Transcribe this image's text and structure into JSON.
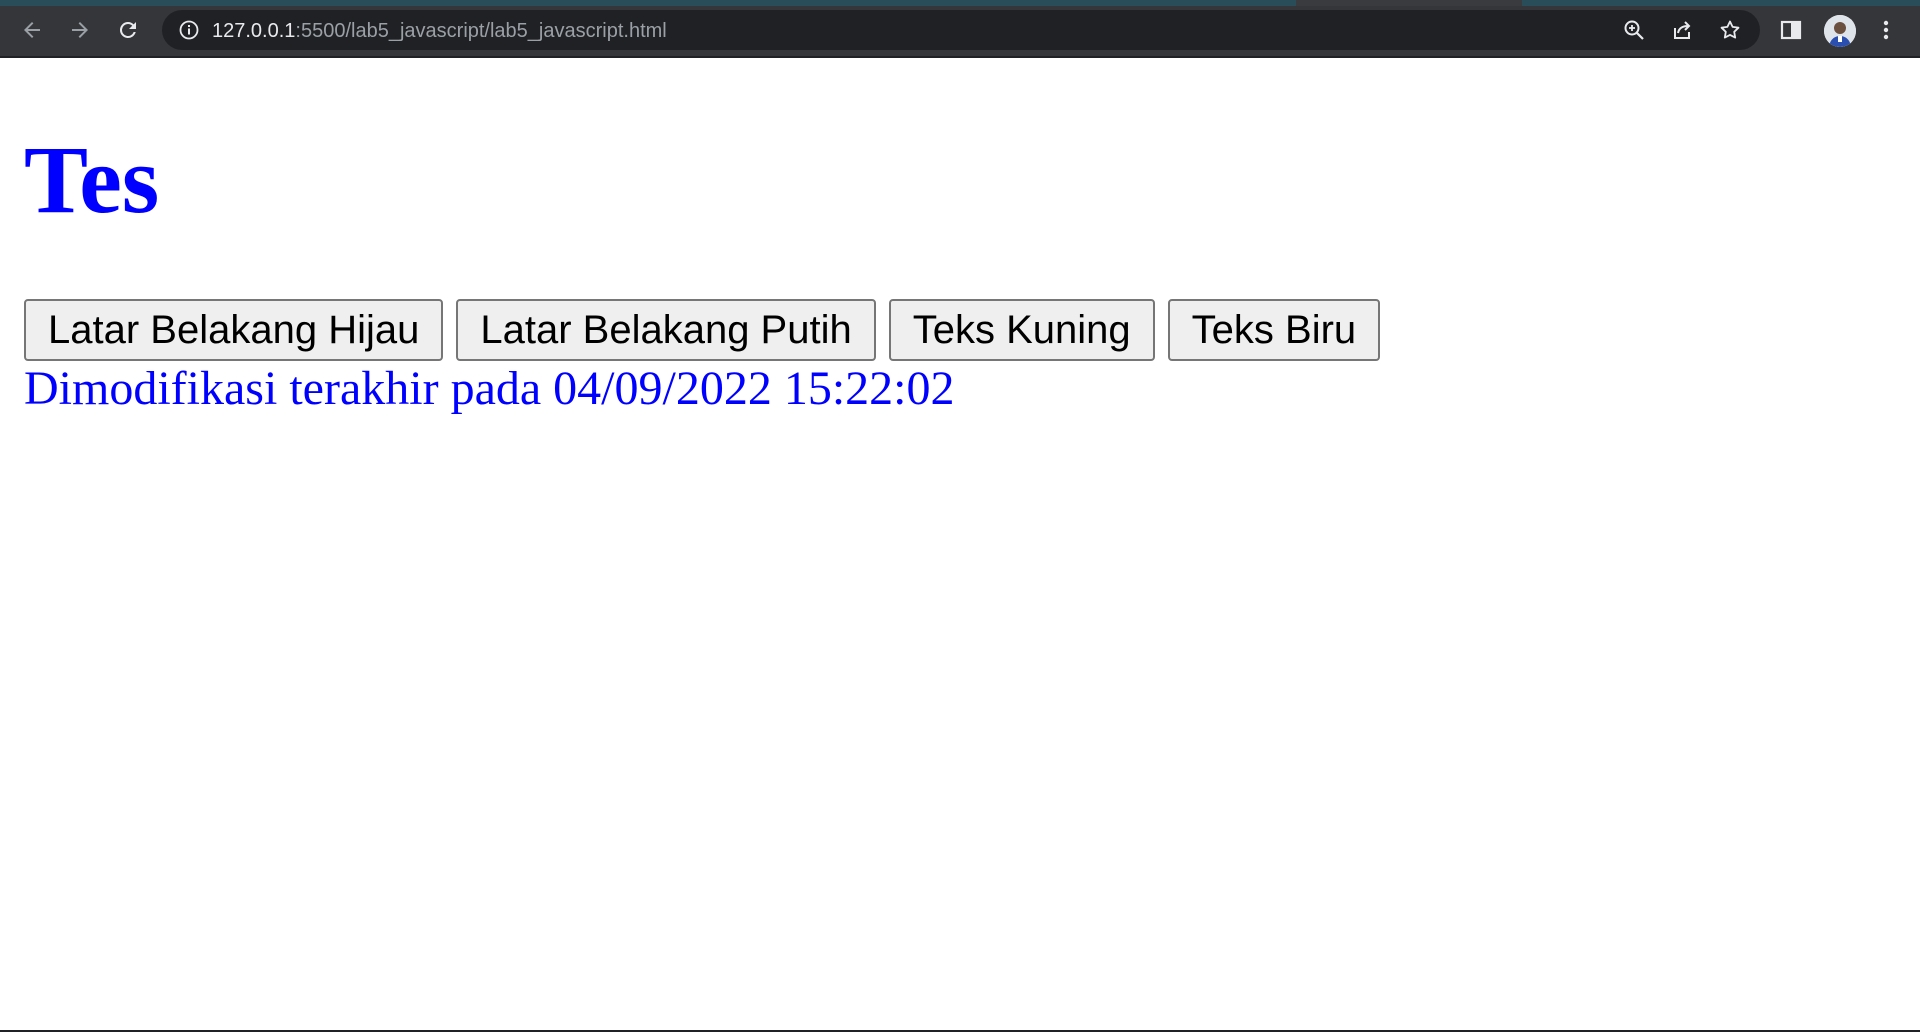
{
  "browser": {
    "url_host": "127.0.0.1",
    "url_rest": ":5500/lab5_javascript/lab5_javascript.html",
    "icons": {
      "back": "back-arrow-icon",
      "forward": "forward-arrow-icon",
      "reload": "reload-icon",
      "site_info": "info-icon",
      "zoom": "zoom-icon",
      "share": "share-icon",
      "bookmark": "star-icon",
      "side_panel": "side-panel-icon",
      "profile": "avatar",
      "menu": "kebab-menu-icon"
    }
  },
  "page": {
    "heading": "Tes",
    "buttons": [
      {
        "label": "Latar Belakang Hijau"
      },
      {
        "label": "Latar Belakang Putih"
      },
      {
        "label": "Teks Kuning"
      },
      {
        "label": "Teks Biru"
      }
    ],
    "modified_text": "Dimodifikasi terakhir pada 04/09/2022 15:22:02"
  },
  "colors": {
    "text_accent": "#0000ff",
    "chrome_bg": "#35363a",
    "omnibox_bg": "#202124",
    "button_bg": "#efefef"
  }
}
